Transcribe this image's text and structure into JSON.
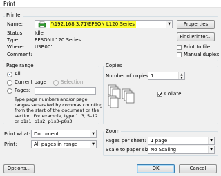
{
  "window": {
    "title": "Print"
  },
  "printer": {
    "legend": "Printer",
    "name_label": "Name:",
    "name_value": "\\\\192.168.3.71\\EPSON L120 Series",
    "properties_button": "Properties",
    "find_printer_button": "Find Printer...",
    "status_label": "Status:",
    "status_value": "Idle",
    "type_label": "Type:",
    "type_value": "EPSON L120 Series",
    "where_label": "Where:",
    "where_value": "USB001",
    "comment_label": "Comment:",
    "print_to_file_label": "Print to file",
    "manual_duplex_label": "Manual duplex"
  },
  "page_range": {
    "legend": "Page range",
    "all_label": "All",
    "current_page_label": "Current page",
    "selection_label": "Selection",
    "pages_label": "Pages:",
    "pages_value": "",
    "help_text_1": "Type page numbers and/or page",
    "help_text_2": "ranges separated by commas counting",
    "help_text_3": "from the start of the document or the",
    "help_text_4": "section. For example, type 1, 3, 5–12",
    "help_text_5": "or p1s1, p1s2, p1s3–p8s3"
  },
  "copies": {
    "legend": "Copies",
    "number_label": "Number of copies:",
    "number_value": "1",
    "collate_label": "Collate",
    "collate_checked": true
  },
  "print_what": {
    "label": "Print what:",
    "value": "Document"
  },
  "print_select": {
    "label": "Print:",
    "value": "All pages in range"
  },
  "zoom": {
    "legend": "Zoom",
    "pages_per_sheet_label": "Pages per sheet:",
    "pages_per_sheet_value": "1 page",
    "scale_label": "Scale to paper size:",
    "scale_value": "No Scaling"
  },
  "buttons": {
    "options": "Options...",
    "ok": "OK",
    "cancel": "Cancel"
  },
  "colors": {
    "highlight": "#ffff33",
    "printer_icon": "#2f9e2f"
  }
}
